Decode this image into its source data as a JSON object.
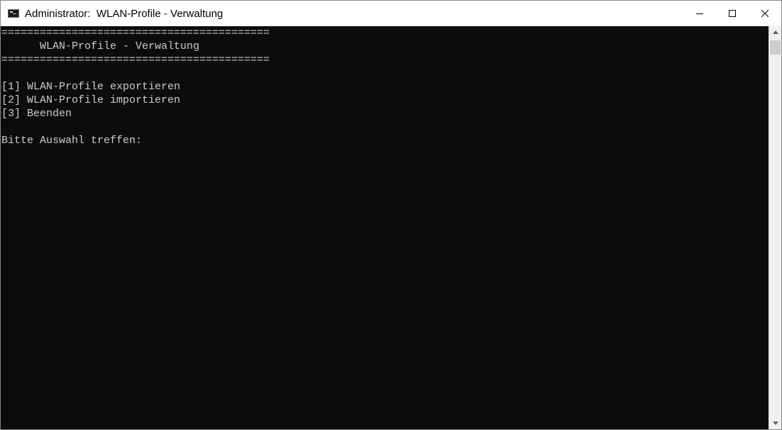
{
  "window": {
    "title": "Administrator:  WLAN-Profile - Verwaltung"
  },
  "controls": {
    "minimize": "minimize-icon",
    "maximize": "maximize-icon",
    "close": "close-icon"
  },
  "console": {
    "lines": [
      "==========================================",
      "      WLAN-Profile - Verwaltung",
      "==========================================",
      "",
      "[1] WLAN-Profile exportieren",
      "[2] WLAN-Profile importieren",
      "[3] Beenden",
      "",
      "Bitte Auswahl treffen:"
    ]
  },
  "colors": {
    "console_bg": "#0c0c0c",
    "console_text": "#cccccc",
    "titlebar_bg": "#ffffff"
  }
}
